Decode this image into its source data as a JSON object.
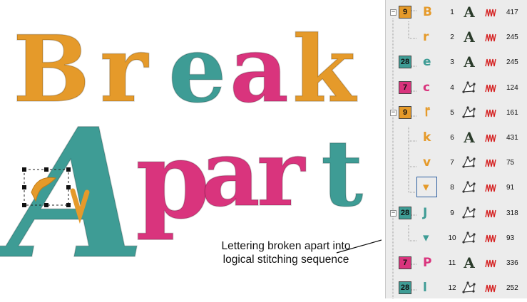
{
  "artwork": {
    "line1": [
      {
        "char": "B",
        "color": "#e59a2a"
      },
      {
        "char": "r",
        "color": "#e59a2a"
      },
      {
        "char": "e",
        "color": "#3e9c95"
      },
      {
        "char": "a",
        "color": "#d9347d"
      },
      {
        "char": "k",
        "color": "#e59a2a"
      }
    ],
    "line2": [
      {
        "char": "A",
        "color": "#3e9c95"
      },
      {
        "char": "p",
        "color": "#d9347d"
      },
      {
        "char": "a",
        "color": "#d9347d"
      },
      {
        "char": "r",
        "color": "#d9347d"
      },
      {
        "char": "t",
        "color": "#3e9c95"
      }
    ]
  },
  "annotation": {
    "line1": "Lettering broken apart into",
    "line2": "logical stitching sequence"
  },
  "colors": {
    "orange": "#e59a2a",
    "teal": "#3e9c95",
    "pink": "#d9347d",
    "stitch_red": "#d62020",
    "selection": "#2d5fa0"
  },
  "sequence": [
    {
      "group": "9",
      "group_color": "#e59a2a",
      "glyph": "B",
      "glyph_color": "#e59a2a",
      "index": "1",
      "type": "A",
      "count": "417",
      "expanded": true
    },
    {
      "group": "",
      "group_color": "",
      "glyph": "r",
      "glyph_color": "#e59a2a",
      "index": "2",
      "type": "A",
      "count": "245"
    },
    {
      "group": "28",
      "group_color": "#3e9c95",
      "glyph": "e",
      "glyph_color": "#3e9c95",
      "index": "3",
      "type": "A",
      "count": "245"
    },
    {
      "group": "7",
      "group_color": "#d9347d",
      "glyph": "c",
      "glyph_color": "#d9347d",
      "index": "4",
      "type": "outline",
      "count": "124"
    },
    {
      "group": "9",
      "group_color": "#e59a2a",
      "glyph": "ٵ",
      "glyph_color": "#e59a2a",
      "index": "5",
      "type": "outline",
      "count": "161",
      "expanded": true
    },
    {
      "group": "",
      "group_color": "",
      "glyph": "k",
      "glyph_color": "#e59a2a",
      "index": "6",
      "type": "A",
      "count": "431"
    },
    {
      "group": "",
      "group_color": "",
      "glyph": "v",
      "glyph_color": "#e59a2a",
      "index": "7",
      "type": "outline",
      "count": "75"
    },
    {
      "group": "",
      "group_color": "",
      "glyph": "▾",
      "glyph_color": "#e59a2a",
      "index": "8",
      "type": "outline",
      "count": "91",
      "selected": true
    },
    {
      "group": "28",
      "group_color": "#3e9c95",
      "glyph": "J",
      "glyph_color": "#3e9c95",
      "index": "9",
      "type": "outline",
      "count": "318",
      "expanded": true
    },
    {
      "group": "",
      "group_color": "",
      "glyph": "▾",
      "glyph_color": "#3e9c95",
      "index": "10",
      "type": "outline",
      "count": "93"
    },
    {
      "group": "7",
      "group_color": "#d9347d",
      "glyph": "P",
      "glyph_color": "#d9347d",
      "index": "11",
      "type": "A",
      "count": "336"
    },
    {
      "group": "28",
      "group_color": "#3e9c95",
      "glyph": "ⅼ",
      "glyph_color": "#3e9c95",
      "index": "12",
      "type": "outline",
      "count": "252"
    }
  ]
}
